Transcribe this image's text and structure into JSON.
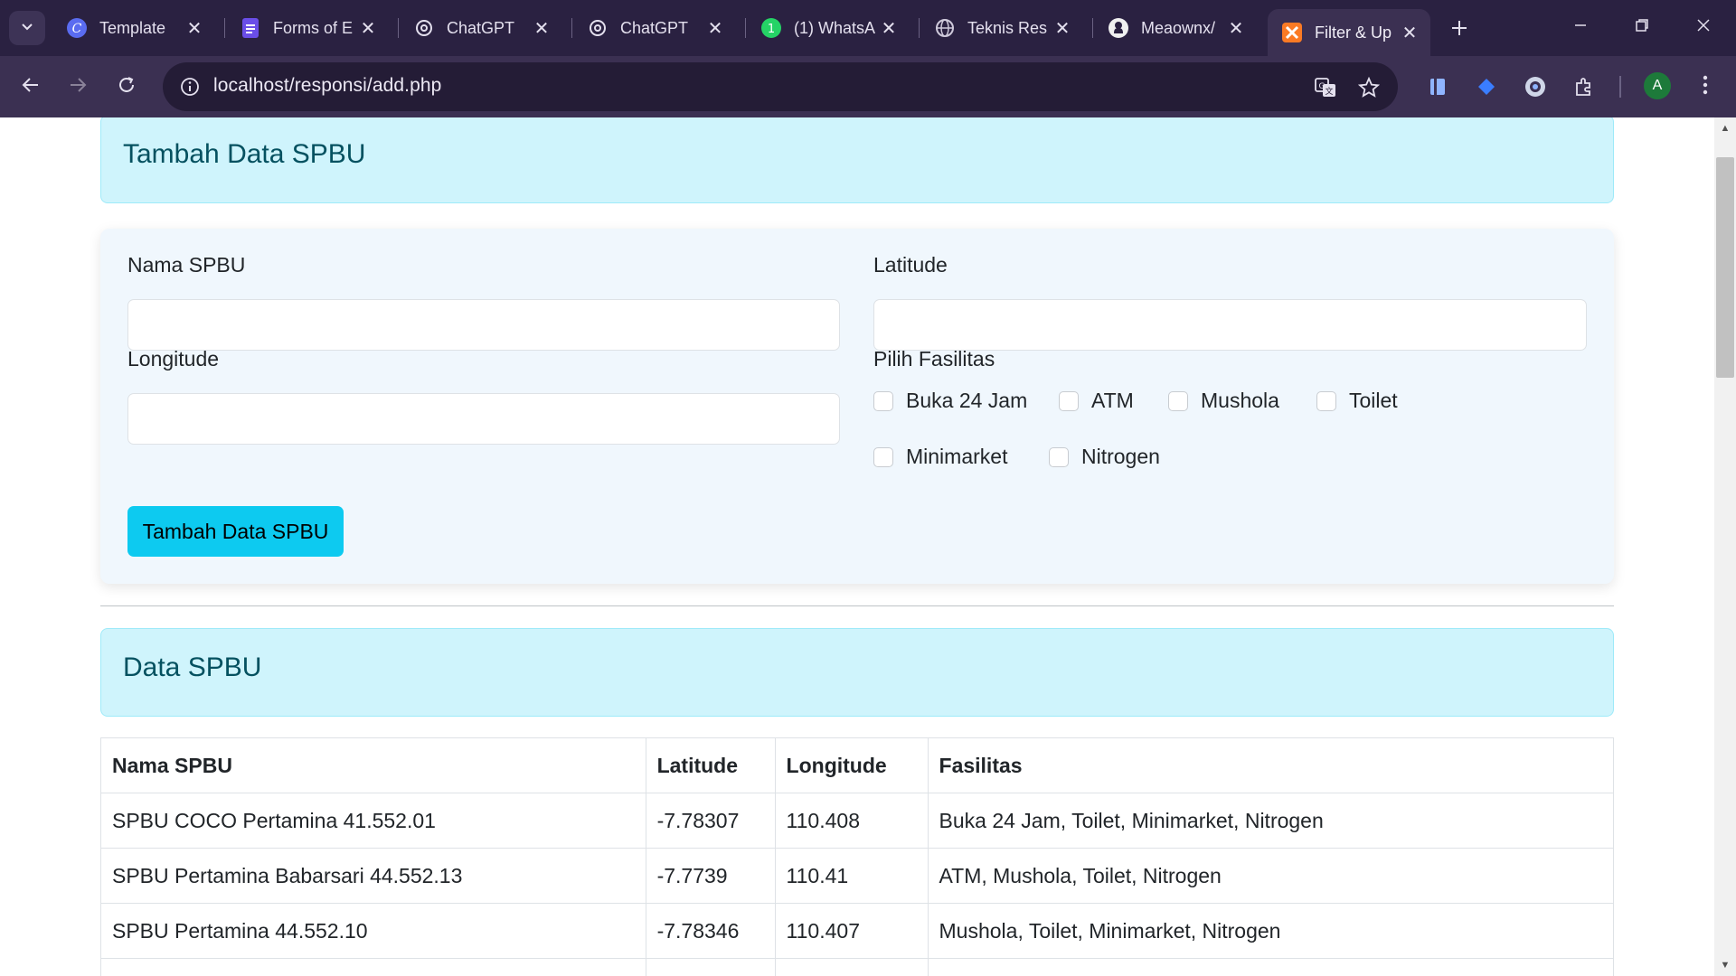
{
  "browser": {
    "tabs": [
      {
        "title": "Template",
        "icon": "canva-icon"
      },
      {
        "title": "Forms of E",
        "icon": "docs-icon"
      },
      {
        "title": "ChatGPT",
        "icon": "chatgpt-icon"
      },
      {
        "title": "ChatGPT",
        "icon": "chatgpt-icon"
      },
      {
        "title": "(1) WhatsA",
        "icon": "whatsapp-icon"
      },
      {
        "title": "Teknis Res",
        "icon": "globe-icon"
      },
      {
        "title": "Meaownx/",
        "icon": "github-icon"
      },
      {
        "title": "Filter & Up",
        "icon": "xampp-icon",
        "active": true
      }
    ],
    "url": "localhost/responsi/add.php",
    "profile_initial": "A"
  },
  "page": {
    "add_heading": "Tambah Data SPBU",
    "form": {
      "nama_label": "Nama SPBU",
      "nama_value": "",
      "latitude_label": "Latitude",
      "latitude_value": "",
      "longitude_label": "Longitude",
      "longitude_value": "",
      "fasilitas_label": "Pilih Fasilitas",
      "fasilitas_options": [
        {
          "label": "Buka 24 Jam",
          "checked": false
        },
        {
          "label": "ATM",
          "checked": false
        },
        {
          "label": "Mushola",
          "checked": false
        },
        {
          "label": "Toilet",
          "checked": false
        },
        {
          "label": "Minimarket",
          "checked": false
        },
        {
          "label": "Nitrogen",
          "checked": false
        }
      ],
      "submit_label": "Tambah Data SPBU"
    },
    "data_heading": "Data SPBU",
    "table": {
      "columns": [
        "Nama SPBU",
        "Latitude",
        "Longitude",
        "Fasilitas"
      ],
      "rows": [
        [
          "SPBU COCO Pertamina 41.552.01",
          "-7.78307",
          "110.408",
          "Buka 24 Jam, Toilet, Minimarket, Nitrogen"
        ],
        [
          "SPBU Pertamina Babarsari 44.552.13",
          "-7.7739",
          "110.41",
          "ATM, Mushola, Toilet, Nitrogen"
        ],
        [
          "SPBU Pertamina 44.552.10",
          "-7.78346",
          "110.407",
          "Mushola, Toilet, Minimarket, Nitrogen"
        ]
      ]
    }
  },
  "colors": {
    "alert_bg": "#cff4fc",
    "alert_text": "#055160",
    "button_bg": "#0dcaf0",
    "card_bg": "#f0f7fd",
    "tabbar_bg": "#2a2141"
  }
}
